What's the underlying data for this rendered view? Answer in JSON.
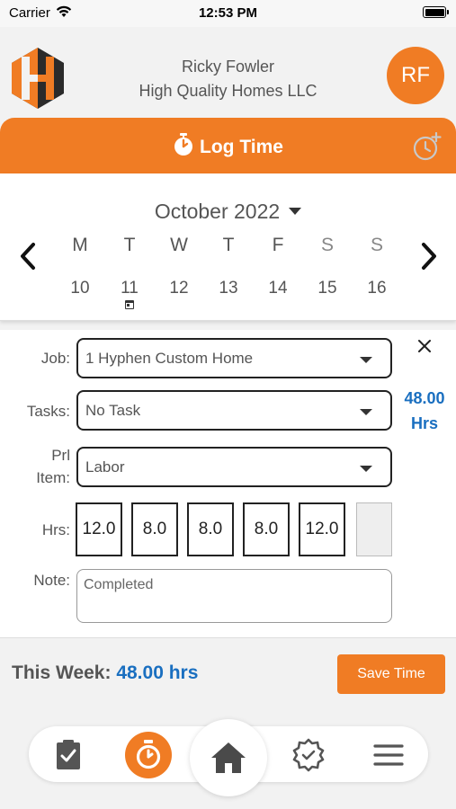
{
  "status_bar": {
    "carrier": "Carrier",
    "time": "12:53 PM"
  },
  "header": {
    "user_name": "Ricky Fowler",
    "company": "High Quality Homes LLC",
    "avatar_initials": "RF"
  },
  "log_bar": {
    "title": "Log Time",
    "icon": "stopwatch-icon",
    "history_icon": "clock-plus-icon"
  },
  "calendar": {
    "month": "October 2022",
    "days": [
      {
        "name": "M",
        "num": "10"
      },
      {
        "name": "T",
        "num": "11",
        "today": true
      },
      {
        "name": "W",
        "num": "12"
      },
      {
        "name": "T",
        "num": "13"
      },
      {
        "name": "F",
        "num": "14"
      },
      {
        "name": "S",
        "num": "15"
      },
      {
        "name": "S",
        "num": "16"
      }
    ]
  },
  "form": {
    "job_label": "Job:",
    "job_value": "1 Hyphen Custom Home",
    "tasks_label": "Tasks:",
    "tasks_value": "No Task",
    "prl_label_line1": "Prl",
    "prl_label_line2": "Item:",
    "prl_value": "Labor",
    "hrs_label": "Hrs:",
    "hours": [
      "12.0",
      "8.0",
      "8.0",
      "8.0",
      "12.0",
      ""
    ],
    "note_label": "Note:",
    "note_value": "Completed",
    "total_value": "48.00",
    "total_unit": "Hrs"
  },
  "week": {
    "label": "This Week:",
    "value": "48.00 hrs",
    "save_label": "Save Time"
  },
  "nav": {
    "items": [
      "clipboard-check-icon",
      "stopwatch-icon",
      "home-icon",
      "badge-check-icon",
      "menu-icon"
    ]
  },
  "colors": {
    "accent": "#f07c24",
    "link_blue": "#1a6fc0",
    "text_gray": "#555555"
  }
}
